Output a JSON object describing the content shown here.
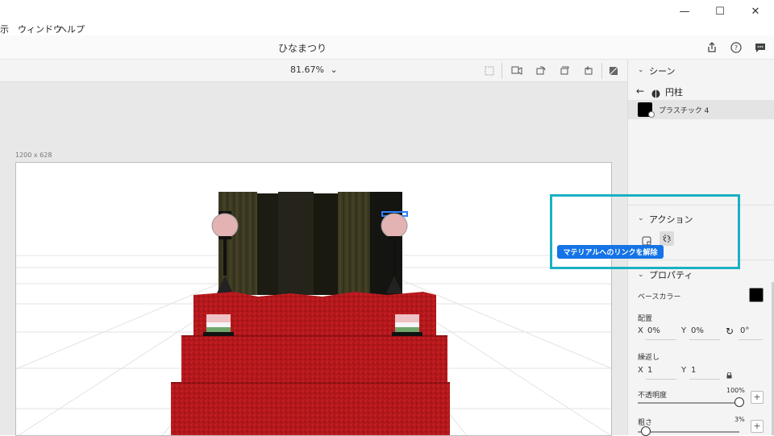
{
  "window": {
    "minimize_glyph": "—",
    "maximize_glyph": "☐",
    "close_glyph": "✕"
  },
  "menu": {
    "items": [
      "示",
      "ウィンドウ",
      "ヘルプ"
    ]
  },
  "document": {
    "title": "ひなまつり"
  },
  "canvas": {
    "zoom": "81.67%",
    "artboard_size": "1200 x 628"
  },
  "panel": {
    "scene_title": "シーン",
    "object_name": "円柱",
    "material_name": "プラスチック 4",
    "actions_title": "アクション",
    "tooltip": "マテリアルへのリンクを解除",
    "properties_title": "プロパティ",
    "base_color_label": "ベースカラー",
    "base_color": "#000000",
    "placement_label": "配置",
    "x_label": "X",
    "x_value": "0%",
    "y_label": "Y",
    "y_value": "0%",
    "rotation_value": "0°",
    "repeat_label": "繰返し",
    "repeat_x_label": "X",
    "repeat_x_value": "1",
    "repeat_y_label": "Y",
    "repeat_y_value": "1",
    "opacity_label": "不透明度",
    "opacity_value": "100%",
    "roughness_label": "粗さ",
    "roughness_value": "3%"
  },
  "colors": {
    "accent": "#1473e6",
    "highlight": "#1ab0c3",
    "carpet": "#b3171b"
  }
}
